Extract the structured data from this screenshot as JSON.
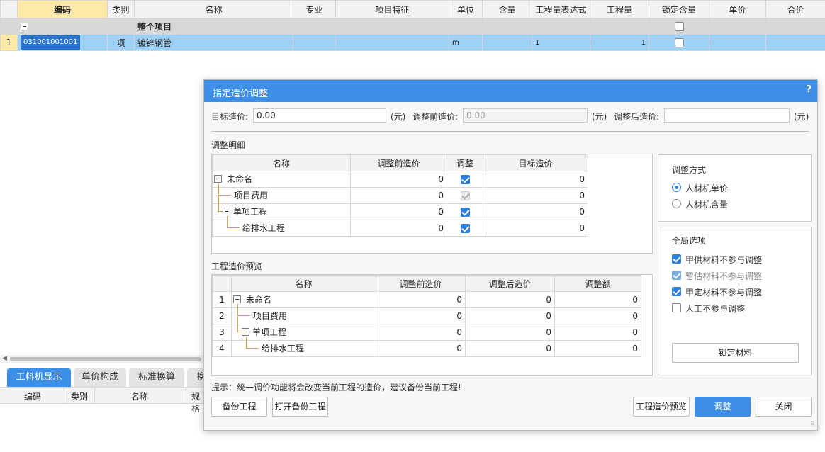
{
  "main_table": {
    "headers": [
      "编码",
      "类别",
      "名称",
      "专业",
      "项目特征",
      "单位",
      "含量",
      "工程量表达式",
      "工程量",
      "锁定含量",
      "单价",
      "合价"
    ],
    "group_row": {
      "name": "整个项目"
    },
    "row1": {
      "num": "1",
      "code": "031001001001",
      "type": "项",
      "name": "镀锌钢管",
      "unit": "m",
      "expr": "1",
      "qty": "1"
    }
  },
  "bottom": {
    "tabs": [
      "工料机显示",
      "单价构成",
      "标准换算",
      "换"
    ],
    "headers": [
      "编码",
      "类别",
      "名称",
      "规格"
    ]
  },
  "dialog": {
    "title": "指定造价调整",
    "help": "?",
    "target_label": "目标造价:",
    "target_value": "0.00",
    "unit_yuan": "(元)",
    "before_label": "调整前造价:",
    "before_placeholder": "0.00",
    "after_label": "调整后造价:",
    "after_value": "",
    "detail_section": "调整明细",
    "detail_headers": [
      "名称",
      "调整前造价",
      "调整",
      "目标造价"
    ],
    "detail_rows": [
      {
        "name": "未命名",
        "before": "0",
        "check": "on",
        "target": "0"
      },
      {
        "name": "项目费用",
        "before": "0",
        "check": "disabled",
        "target": "0"
      },
      {
        "name": "单项工程",
        "before": "0",
        "check": "on",
        "target": "0"
      },
      {
        "name": "给排水工程",
        "before": "0",
        "check": "on",
        "target": "0"
      }
    ],
    "preview_section": "工程造价预览",
    "preview_headers": [
      "名称",
      "调整前造价",
      "调整后造价",
      "调整额"
    ],
    "preview_rows": [
      {
        "idx": "1",
        "name": "未命名",
        "before": "0",
        "after": "0",
        "diff": "0"
      },
      {
        "idx": "2",
        "name": "项目费用",
        "before": "0",
        "after": "0",
        "diff": "0"
      },
      {
        "idx": "3",
        "name": "单项工程",
        "before": "0",
        "after": "0",
        "diff": "0"
      },
      {
        "idx": "4",
        "name": "给排水工程",
        "before": "0",
        "after": "0",
        "diff": "0"
      }
    ],
    "method_title": "调整方式",
    "method_options": [
      "人材机单价",
      "人材机含量"
    ],
    "method_selected": "人材机单价",
    "global_title": "全局选项",
    "global_options": [
      {
        "label": "甲供材料不参与调整",
        "state": "on"
      },
      {
        "label": "暂估材料不参与调整",
        "state": "disabled"
      },
      {
        "label": "甲定材料不参与调整",
        "state": "on"
      },
      {
        "label": "人工不参与调整",
        "state": "off"
      }
    ],
    "lock_material_button": "锁定材料",
    "hint": "提示：统一调价功能将会改变当前工程的造价，建议备份当前工程!",
    "buttons": {
      "backup": "备份工程",
      "open_backup": "打开备份工程",
      "preview": "工程造价预览",
      "adjust": "调整",
      "close": "关闭"
    }
  }
}
